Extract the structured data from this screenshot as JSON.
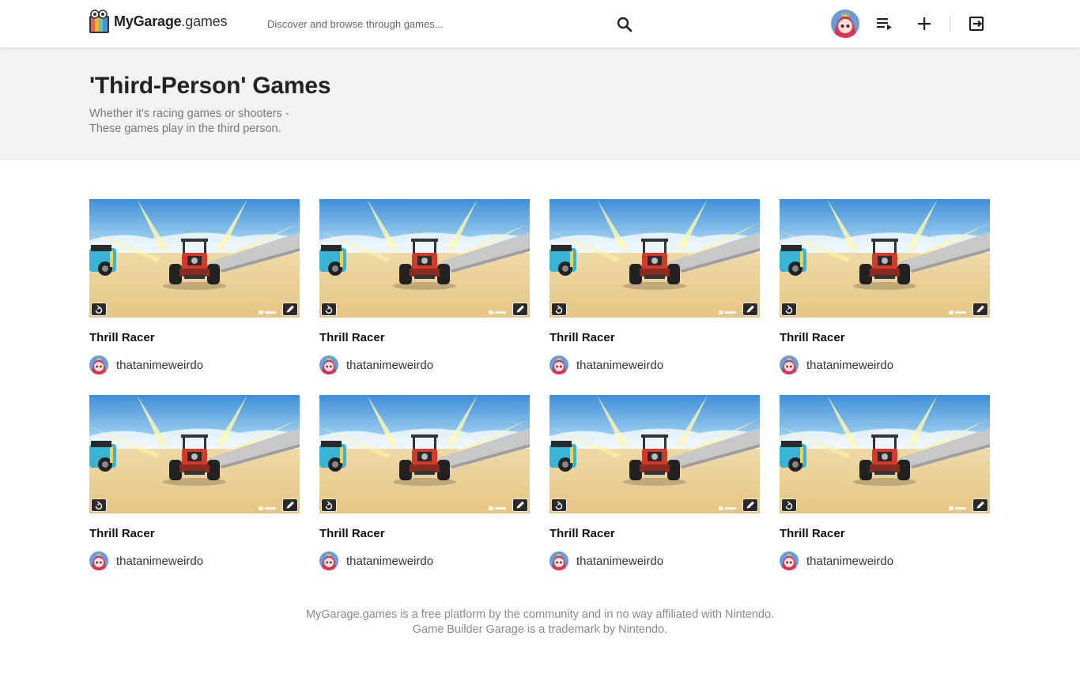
{
  "brand": {
    "name": "MyGarage",
    "domain": ".games"
  },
  "search": {
    "placeholder": "Discover and browse through games..."
  },
  "header_icons": [
    "user-avatar",
    "playlist-icon",
    "add-icon",
    "logout-icon"
  ],
  "page": {
    "title": "'Third-Person' Games",
    "description": "Whether it's racing games or shooters - These games play in the third person."
  },
  "games": [
    {
      "title": "Thrill Racer",
      "author": "thatanimeweirdo"
    },
    {
      "title": "Thrill Racer",
      "author": "thatanimeweirdo"
    },
    {
      "title": "Thrill Racer",
      "author": "thatanimeweirdo"
    },
    {
      "title": "Thrill Racer",
      "author": "thatanimeweirdo"
    },
    {
      "title": "Thrill Racer",
      "author": "thatanimeweirdo"
    },
    {
      "title": "Thrill Racer",
      "author": "thatanimeweirdo"
    },
    {
      "title": "Thrill Racer",
      "author": "thatanimeweirdo"
    },
    {
      "title": "Thrill Racer",
      "author": "thatanimeweirdo"
    }
  ],
  "footer": {
    "line1": "MyGarage.games is a free platform by the community and in no way affiliated with Nintendo.",
    "line2": "Game Builder Garage is a trademark by Nintendo."
  },
  "colors": {
    "hero_bg": "#f2f2f2",
    "text_muted": "#777777",
    "footer_text": "#8a8a8a"
  }
}
